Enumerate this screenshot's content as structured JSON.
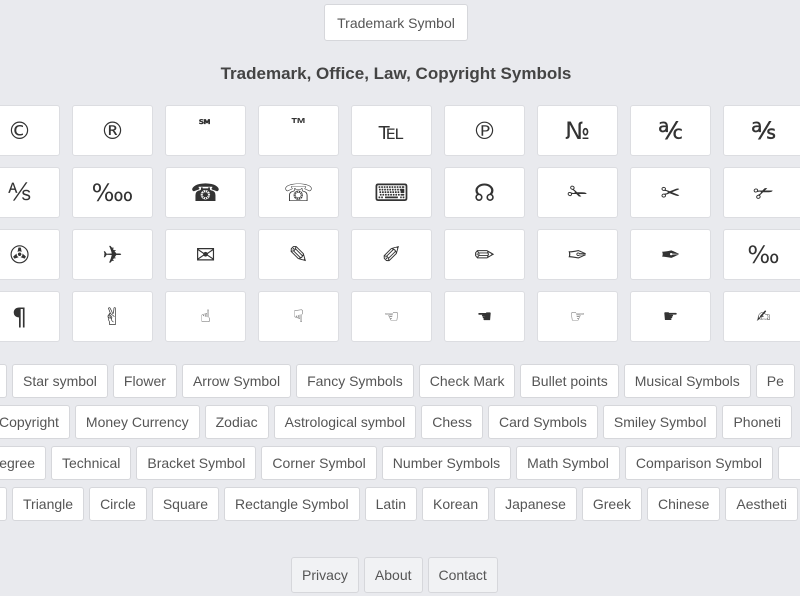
{
  "header": {
    "button_label": "Trademark Symbol",
    "title": "Trademark, Office, Law, Copyright Symbols"
  },
  "symbols": [
    [
      "©",
      "®",
      "℠",
      "™",
      "℡",
      "℗",
      "№",
      "℀",
      "℁"
    ],
    [
      "⅍",
      "‱",
      "☎",
      "☏",
      "⌨",
      "☊",
      "✁",
      "✂",
      "✃"
    ],
    [
      "✇",
      "✈",
      "✉",
      "✎",
      "✐",
      "✏",
      "✑",
      "✒",
      "‰"
    ],
    [
      "¶",
      "✌",
      "☝",
      "☟",
      "☜",
      "☚",
      "☞",
      "☛",
      "✍"
    ]
  ],
  "categories": [
    [
      "",
      "Star symbol",
      "Flower",
      "Arrow Symbol",
      "Fancy Symbols",
      "Check Mark",
      "Bullet points",
      "Musical Symbols",
      "Pe"
    ],
    [
      "Copyright",
      "Money Currency",
      "Zodiac",
      "Astrological symbol",
      "Chess",
      "Card Symbols",
      "Smiley Symbol",
      "Phoneti"
    ],
    [
      "egree",
      "Technical",
      "Bracket Symbol",
      "Corner Symbol",
      "Number Symbols",
      "Math Symbol",
      "Comparison Symbol",
      ""
    ],
    [
      "",
      "Triangle",
      "Circle",
      "Square",
      "Rectangle Symbol",
      "Latin",
      "Korean",
      "Japanese",
      "Greek",
      "Chinese",
      "Aestheti"
    ]
  ],
  "footer": {
    "links": [
      "Privacy",
      "About",
      "Contact"
    ]
  }
}
